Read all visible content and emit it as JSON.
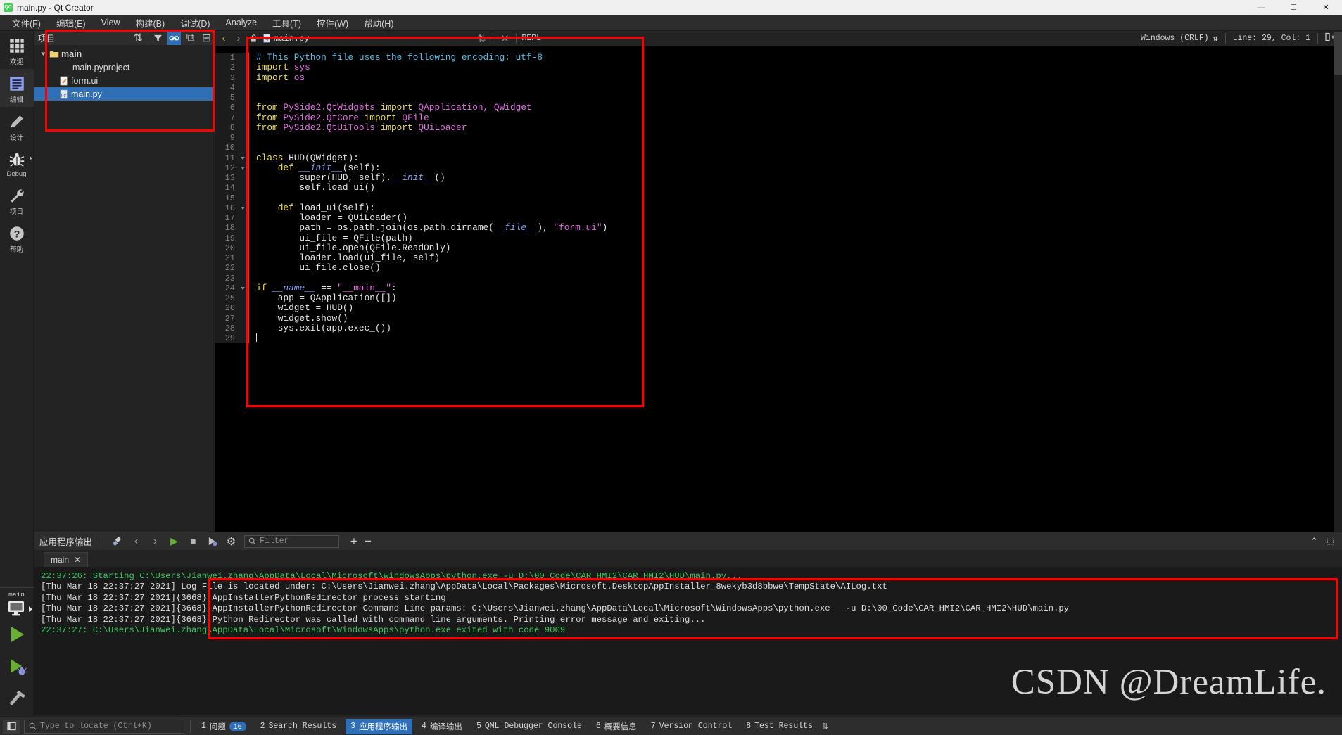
{
  "window": {
    "title": "main.py - Qt Creator",
    "logo_text": "QC",
    "controls": {
      "minimize": "—",
      "maximize": "☐",
      "close": "✕"
    }
  },
  "menubar": {
    "items": [
      {
        "label": "文件(F)",
        "name": "menu-file"
      },
      {
        "label": "编辑(E)",
        "name": "menu-edit"
      },
      {
        "label": "View",
        "name": "menu-view"
      },
      {
        "label": "构建(B)",
        "name": "menu-build"
      },
      {
        "label": "调试(D)",
        "name": "menu-debug"
      },
      {
        "label": "Analyze",
        "name": "menu-analyze"
      },
      {
        "label": "工具(T)",
        "name": "menu-tools"
      },
      {
        "label": "控件(W)",
        "name": "menu-window"
      },
      {
        "label": "帮助(H)",
        "name": "menu-help"
      }
    ]
  },
  "modebar": {
    "items": [
      {
        "label": "欢迎",
        "icon": "grid-icon",
        "active": false
      },
      {
        "label": "编辑",
        "icon": "edit-document-icon",
        "active": true
      },
      {
        "label": "设计",
        "icon": "pencil-icon",
        "active": false
      },
      {
        "label": "Debug",
        "icon": "bug-icon",
        "active": false,
        "has_arrow": true
      },
      {
        "label": "项目",
        "icon": "wrench-icon",
        "active": false
      },
      {
        "label": "帮助",
        "icon": "help-question-icon",
        "active": false
      }
    ],
    "kit": {
      "name": "main",
      "icon": "monitor-icon"
    },
    "run_label": "run-button",
    "debug_label": "run-debug-button",
    "build_label": "build-hammer-button"
  },
  "project_pane": {
    "title": "项目",
    "header_buttons": [
      {
        "name": "filter-sort-icon",
        "glyph": "⇅"
      },
      {
        "name": "filter-icon",
        "glyph": "▼"
      },
      {
        "name": "link-sync-icon",
        "glyph": "⚭",
        "active": true
      },
      {
        "name": "split-icon",
        "glyph": "⧉"
      },
      {
        "name": "close-pane-icon",
        "glyph": "⊟"
      }
    ],
    "tree": [
      {
        "label": "main",
        "icon": "folder-icon",
        "depth": 0,
        "expanded": true,
        "bold": true,
        "selected": false
      },
      {
        "label": "main.pyproject",
        "icon": "none",
        "depth": 2,
        "bold": false,
        "selected": false
      },
      {
        "label": "form.ui",
        "icon": "ui-file-icon",
        "depth": 1,
        "bold": false,
        "selected": false
      },
      {
        "label": "main.py",
        "icon": "py-file-icon",
        "depth": 1,
        "bold": false,
        "selected": true
      }
    ]
  },
  "editor": {
    "toolbar": {
      "back": "‹",
      "forward": "›",
      "lock_icon": "unlocked-padlock-icon",
      "file_icon": "py-file-icon",
      "filename": "main.py",
      "dropdown": "⇅",
      "close": "✕",
      "repl": "REPL",
      "line_ending": "Windows (CRLF)",
      "line_ending_dropdown": "⇅",
      "cursor_position": "Line: 29, Col: 1",
      "split_icon": "split-editor-icon"
    },
    "lines": [
      {
        "n": 1,
        "fold": false,
        "tokens": [
          {
            "t": "# This Python file uses the following encoding: utf-8",
            "c": "c-com"
          }
        ]
      },
      {
        "n": 2,
        "fold": false,
        "tokens": [
          {
            "t": "import ",
            "c": "c-kw"
          },
          {
            "t": "sys",
            "c": "c-mod"
          }
        ]
      },
      {
        "n": 3,
        "fold": false,
        "tokens": [
          {
            "t": "import ",
            "c": "c-kw"
          },
          {
            "t": "os",
            "c": "c-mod"
          }
        ]
      },
      {
        "n": 4,
        "fold": false,
        "tokens": []
      },
      {
        "n": 5,
        "fold": false,
        "tokens": []
      },
      {
        "n": 6,
        "fold": false,
        "tokens": [
          {
            "t": "from ",
            "c": "c-kw"
          },
          {
            "t": "PySide2.QtWidgets",
            "c": "c-mod"
          },
          {
            "t": " import ",
            "c": "c-kw"
          },
          {
            "t": "QApplication, QWidget",
            "c": "c-mod"
          }
        ]
      },
      {
        "n": 7,
        "fold": false,
        "tokens": [
          {
            "t": "from ",
            "c": "c-kw"
          },
          {
            "t": "PySide2.QtCore",
            "c": "c-mod"
          },
          {
            "t": " import ",
            "c": "c-kw"
          },
          {
            "t": "QFile",
            "c": "c-mod"
          }
        ]
      },
      {
        "n": 8,
        "fold": false,
        "tokens": [
          {
            "t": "from ",
            "c": "c-kw"
          },
          {
            "t": "PySide2.QtUiTools",
            "c": "c-mod"
          },
          {
            "t": " import ",
            "c": "c-kw"
          },
          {
            "t": "QUiLoader",
            "c": "c-mod"
          }
        ]
      },
      {
        "n": 9,
        "fold": false,
        "tokens": []
      },
      {
        "n": 10,
        "fold": false,
        "tokens": []
      },
      {
        "n": 11,
        "fold": true,
        "tokens": [
          {
            "t": "class ",
            "c": "c-kw"
          },
          {
            "t": "HUD(QWidget):",
            "c": "c-plain"
          }
        ]
      },
      {
        "n": 12,
        "fold": true,
        "tokens": [
          {
            "t": "    ",
            "c": "c-plain"
          },
          {
            "t": "def ",
            "c": "c-kw"
          },
          {
            "t": "__init__",
            "c": "c-magic"
          },
          {
            "t": "(self):",
            "c": "c-plain"
          }
        ]
      },
      {
        "n": 13,
        "fold": false,
        "tokens": [
          {
            "t": "        super(HUD, self).",
            "c": "c-plain"
          },
          {
            "t": "__init__",
            "c": "c-magic"
          },
          {
            "t": "()",
            "c": "c-plain"
          }
        ]
      },
      {
        "n": 14,
        "fold": false,
        "tokens": [
          {
            "t": "        self.load_ui()",
            "c": "c-plain"
          }
        ]
      },
      {
        "n": 15,
        "fold": false,
        "tokens": []
      },
      {
        "n": 16,
        "fold": true,
        "tokens": [
          {
            "t": "    ",
            "c": "c-plain"
          },
          {
            "t": "def ",
            "c": "c-kw"
          },
          {
            "t": "load_ui(self):",
            "c": "c-plain"
          }
        ]
      },
      {
        "n": 17,
        "fold": false,
        "tokens": [
          {
            "t": "        loader = QUiLoader()",
            "c": "c-plain"
          }
        ]
      },
      {
        "n": 18,
        "fold": false,
        "tokens": [
          {
            "t": "        path = os.path.join(os.path.dirname(",
            "c": "c-plain"
          },
          {
            "t": "__file__",
            "c": "c-magic"
          },
          {
            "t": "), ",
            "c": "c-plain"
          },
          {
            "t": "\"form.ui\"",
            "c": "c-str"
          },
          {
            "t": ")",
            "c": "c-plain"
          }
        ]
      },
      {
        "n": 19,
        "fold": false,
        "tokens": [
          {
            "t": "        ui_file = QFile(path)",
            "c": "c-plain"
          }
        ]
      },
      {
        "n": 20,
        "fold": false,
        "tokens": [
          {
            "t": "        ui_file.open(QFile.ReadOnly)",
            "c": "c-plain"
          }
        ]
      },
      {
        "n": 21,
        "fold": false,
        "tokens": [
          {
            "t": "        loader.load(ui_file, self)",
            "c": "c-plain"
          }
        ]
      },
      {
        "n": 22,
        "fold": false,
        "tokens": [
          {
            "t": "        ui_file.close()",
            "c": "c-plain"
          }
        ]
      },
      {
        "n": 23,
        "fold": false,
        "tokens": []
      },
      {
        "n": 24,
        "fold": true,
        "tokens": [
          {
            "t": "if ",
            "c": "c-kw"
          },
          {
            "t": "__name__",
            "c": "c-magic"
          },
          {
            "t": " == ",
            "c": "c-plain"
          },
          {
            "t": "\"__main__\"",
            "c": "c-str"
          },
          {
            "t": ":",
            "c": "c-plain"
          }
        ]
      },
      {
        "n": 25,
        "fold": false,
        "tokens": [
          {
            "t": "    app = QApplication([])",
            "c": "c-plain"
          }
        ]
      },
      {
        "n": 26,
        "fold": false,
        "tokens": [
          {
            "t": "    widget = HUD()",
            "c": "c-plain"
          }
        ]
      },
      {
        "n": 27,
        "fold": false,
        "tokens": [
          {
            "t": "    widget.show()",
            "c": "c-plain"
          }
        ]
      },
      {
        "n": 28,
        "fold": false,
        "tokens": [
          {
            "t": "    sys.exit(app.exec_())",
            "c": "c-plain"
          }
        ]
      },
      {
        "n": 29,
        "fold": false,
        "tokens": [],
        "cursor": true
      }
    ]
  },
  "output_pane": {
    "title": "应用程序输出",
    "buttons": [
      {
        "name": "clear-output-icon",
        "glyph": "⎘"
      },
      {
        "name": "prev-item-icon",
        "glyph": "‹"
      },
      {
        "name": "next-item-icon",
        "glyph": "›"
      },
      {
        "name": "run-icon",
        "glyph": "▶"
      },
      {
        "name": "stop-icon",
        "glyph": "■"
      },
      {
        "name": "attach-debugger-icon",
        "glyph": "◢"
      },
      {
        "name": "settings-gear-icon",
        "glyph": "⚙"
      }
    ],
    "filter_placeholder": "Filter",
    "zoom_in": "+",
    "zoom_out": "−",
    "collapse_icon": "⌃",
    "maximize_icon": "⬚",
    "tab": {
      "label": "main",
      "close": "✕"
    },
    "console_lines": [
      {
        "text": "22:37:26: Starting C:\\Users\\Jianwei.zhang\\AppData\\Local\\Microsoft\\WindowsApps\\python.exe -u D:\\00_Code\\CAR_HMI2\\CAR_HMI2\\HUD\\main.py...",
        "color": "green"
      },
      {
        "text": "[Thu Mar 18 22:37:27 2021] Log File is located under: C:\\Users\\Jianwei.zhang\\AppData\\Local\\Packages\\Microsoft.DesktopAppInstaller_8wekyb3d8bbwe\\TempState\\AILog.txt",
        "color": "white"
      },
      {
        "text": "[Thu Mar 18 22:37:27 2021]{3668} AppInstallerPythonRedirector process starting",
        "color": "white"
      },
      {
        "text": "[Thu Mar 18 22:37:27 2021]{3668} AppInstallerPythonRedirector Command Line params: C:\\Users\\Jianwei.zhang\\AppData\\Local\\Microsoft\\WindowsApps\\python.exe   -u D:\\00_Code\\CAR_HMI2\\CAR_HMI2\\HUD\\main.py",
        "color": "white"
      },
      {
        "text": "[Thu Mar 18 22:37:27 2021]{3668} Python Redirector was called with command line arguments. Printing error message and exiting...",
        "color": "white"
      },
      {
        "text": "22:37:27: C:\\Users\\Jianwei.zhang\\AppData\\Local\\Microsoft\\WindowsApps\\python.exe exited with code 9009",
        "color": "green"
      }
    ]
  },
  "statusbar": {
    "sidebar_toggle": "◫",
    "locator_placeholder": "Type to locate (Ctrl+K)",
    "items": [
      {
        "num": "1",
        "label": "问题",
        "badge": "16",
        "active": false
      },
      {
        "num": "2",
        "label": "Search Results",
        "badge": "",
        "active": false
      },
      {
        "num": "3",
        "label": "应用程序输出",
        "badge": "",
        "active": true
      },
      {
        "num": "4",
        "label": "编译输出",
        "badge": "",
        "active": false
      },
      {
        "num": "5",
        "label": "QML Debugger Console",
        "badge": "",
        "active": false
      },
      {
        "num": "6",
        "label": "概要信息",
        "badge": "",
        "active": false
      },
      {
        "num": "7",
        "label": "Version Control",
        "badge": "",
        "active": false
      },
      {
        "num": "8",
        "label": "Test Results",
        "badge": "",
        "active": false
      }
    ],
    "more_arrows": "⇅"
  },
  "watermark": {
    "text": "CSDN @DreamLife."
  },
  "colors": {
    "accent": "#2e6fb5",
    "annotation_red": "#ff0000",
    "console_green": "#36c95e",
    "qt_green": "#41cd52"
  }
}
